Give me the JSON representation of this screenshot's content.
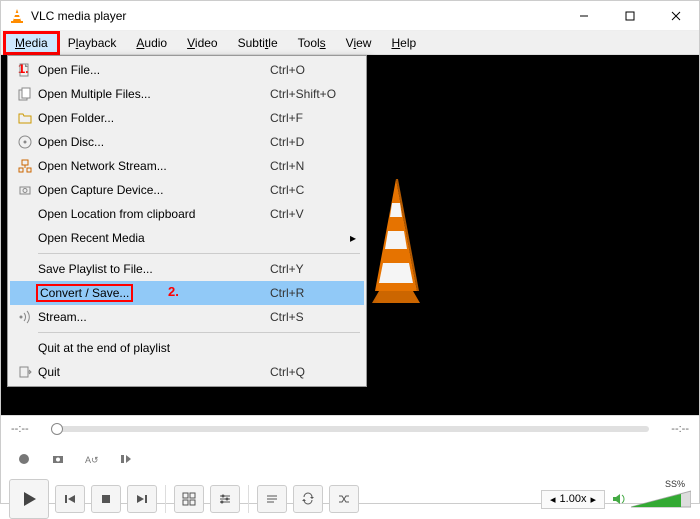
{
  "titlebar": {
    "title": "VLC media player"
  },
  "menubar": {
    "items": [
      {
        "label": "Media",
        "ul": "M"
      },
      {
        "label": "Playback",
        "ul": "L"
      },
      {
        "label": "Audio",
        "ul": "A"
      },
      {
        "label": "Video",
        "ul": "V"
      },
      {
        "label": "Subtitle",
        "ul": ""
      },
      {
        "label": "Tools",
        "ul": ""
      },
      {
        "label": "View",
        "ul": "V"
      },
      {
        "label": "Help",
        "ul": "H"
      }
    ]
  },
  "dropdown": {
    "items": [
      {
        "icon": "file",
        "label": "Open File...",
        "shortcut": "Ctrl+O"
      },
      {
        "icon": "files",
        "label": "Open Multiple Files...",
        "shortcut": "Ctrl+Shift+O"
      },
      {
        "icon": "folder",
        "label": "Open Folder...",
        "shortcut": "Ctrl+F"
      },
      {
        "icon": "disc",
        "label": "Open Disc...",
        "shortcut": "Ctrl+D"
      },
      {
        "icon": "network",
        "label": "Open Network Stream...",
        "shortcut": "Ctrl+N"
      },
      {
        "icon": "capture",
        "label": "Open Capture Device...",
        "shortcut": "Ctrl+C"
      },
      {
        "icon": "",
        "label": "Open Location from clipboard",
        "shortcut": "Ctrl+V"
      },
      {
        "icon": "",
        "label": "Open Recent Media",
        "shortcut": "",
        "submenu": true
      },
      {
        "sep": true
      },
      {
        "icon": "",
        "label": "Save Playlist to File...",
        "shortcut": "Ctrl+Y"
      },
      {
        "icon": "",
        "label": "Convert / Save...",
        "shortcut": "Ctrl+R",
        "highlight": true,
        "redbox": true
      },
      {
        "icon": "stream",
        "label": "Stream...",
        "shortcut": "Ctrl+S"
      },
      {
        "sep": true
      },
      {
        "icon": "",
        "label": "Quit at the end of playlist",
        "shortcut": ""
      },
      {
        "icon": "quit",
        "label": "Quit",
        "shortcut": "Ctrl+Q"
      }
    ]
  },
  "annotations": {
    "one": "1.",
    "two": "2."
  },
  "seek": {
    "left": "--:--",
    "right": "--:--"
  },
  "controls": {
    "speed": "1.00x",
    "volume_pct": "SS%"
  },
  "colors": {
    "highlight": "#91c9f7",
    "annotation": "#f00"
  }
}
